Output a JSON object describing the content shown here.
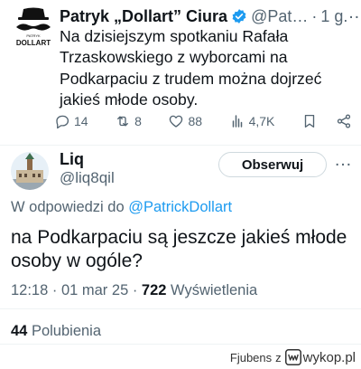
{
  "tweet1": {
    "author_name": "Patryk „Dollart” Ciura",
    "handle": "@Pat…",
    "separator": "·",
    "time": "1 g.",
    "more_icon": "…",
    "avatar_text": "DOLLART",
    "text": "Na dzisiejszym spotkaniu Rafała Trzaskowskiego z wyborcami na Podkarpaciu z trudem można dojrzeć jakieś młode osoby.",
    "actions": {
      "replies": "14",
      "retweets": "8",
      "likes": "88",
      "views": "4,7K"
    }
  },
  "tweet2": {
    "author_name": "Liq",
    "handle": "@liq8qil",
    "follow_label": "Obserwuj",
    "more_icon": "…",
    "reply_prefix": "W odpowiedzi do",
    "reply_mention": "@PatrickDollart",
    "text": "na Podkarpaciu są jeszcze jakieś młode osoby w ogóle?",
    "timestamp": "12:18 · 01 mar 25 ·",
    "views_count": "722",
    "views_label": "Wyświetlenia",
    "likes_count": "44",
    "likes_label": "Polubienia"
  },
  "watermark": {
    "user": "Fjubens",
    "z": "z",
    "site": "wykop.pl"
  },
  "colors": {
    "text_primary": "#0f1419",
    "text_secondary": "#536471",
    "link": "#1d9bf0",
    "verified": "#1d9bf0",
    "divider": "#eff3f4"
  }
}
